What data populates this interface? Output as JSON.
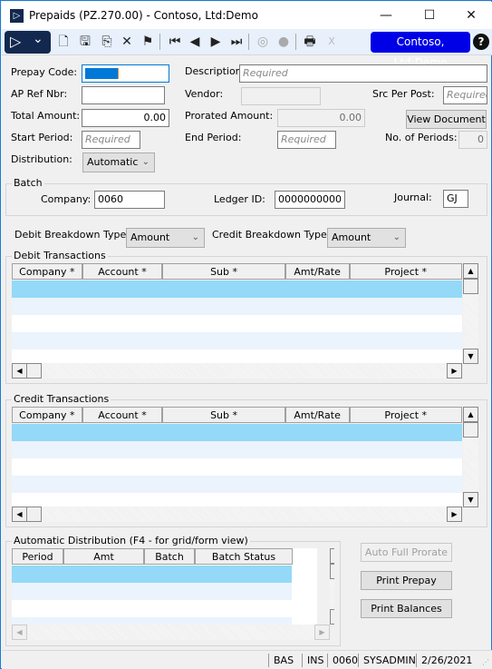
{
  "window": {
    "title": "Prepaids (PZ.270.00) - Contoso, Ltd:Demo",
    "minimize": "—",
    "maximize": "☐",
    "close": "✕"
  },
  "toolbar": {
    "main_menu_icon": "▷",
    "main_menu_chevron": "⌄",
    "icons": {
      "new": "🗋",
      "save": "🖫",
      "finish": "⎘",
      "delete": "✕",
      "cancel": "⚑",
      "first": "⏮",
      "prev": "◀",
      "next": "▶",
      "last": "⏭",
      "attach": "◎",
      "notes": "●",
      "print": "🖶",
      "excel": "X"
    },
    "company_badge": "Contoso, Ltd:Demo",
    "help": "?"
  },
  "form": {
    "prepay_code_label": "Prepay Code:",
    "prepay_code_value": "",
    "description_label": "Description:",
    "description_placeholder": "Required",
    "ap_ref_nbr_label": "AP Ref Nbr:",
    "ap_ref_nbr_value": "",
    "vendor_label": "Vendor:",
    "vendor_value": "",
    "src_per_post_label": "Src Per Post:",
    "src_per_post_placeholder": "Required",
    "total_amount_label": "Total Amount:",
    "total_amount_value": "0.00",
    "prorated_amount_label": "Prorated Amount:",
    "prorated_amount_value": "0.00",
    "view_document_button": "View Document",
    "start_period_label": "Start Period:",
    "start_period_placeholder": "Required",
    "end_period_label": "End Period:",
    "end_period_placeholder": "Required",
    "no_of_periods_label": "No. of Periods:",
    "no_of_periods_value": "0",
    "distribution_label": "Distribution:",
    "distribution_value": "Automatic"
  },
  "batch": {
    "title": "Batch",
    "company_label": "Company:",
    "company_value": "0060",
    "ledger_id_label": "Ledger ID:",
    "ledger_id_value": "0000000000",
    "journal_label": "Journal:",
    "journal_value": "GJ"
  },
  "breakdown": {
    "debit_label": "Debit Breakdown Type:",
    "debit_value": "Amount",
    "credit_label": "Credit Breakdown Type:",
    "credit_value": "Amount"
  },
  "debit_transactions": {
    "title": "Debit Transactions",
    "columns": [
      "Company *",
      "Account *",
      "Sub *",
      "Amt/Rate",
      "Project *"
    ]
  },
  "credit_transactions": {
    "title": "Credit Transactions",
    "columns": [
      "Company *",
      "Account *",
      "Sub *",
      "Amt/Rate",
      "Project *"
    ]
  },
  "auto_distribution": {
    "title": "Automatic Distribution (F4 - for grid/form view)",
    "columns": [
      "Period",
      "Amt",
      "Batch",
      "Batch Status"
    ]
  },
  "buttons": {
    "auto_full_prorate": "Auto Full Prorate",
    "print_prepay": "Print Prepay",
    "print_balances": "Print Balances"
  },
  "scroll": {
    "up": "▲",
    "down": "▼",
    "left": "◀",
    "right": "▶"
  },
  "status": {
    "mode": "BAS",
    "insert": "INS",
    "company": "0060",
    "user": "SYSADMIN",
    "date": "2/26/2021"
  },
  "colors": {
    "accent": "#0078d7",
    "company_badge": "#0000e6",
    "menu_dark": "#13284e",
    "selected_row": "#94d9f7",
    "alt_row": "#ebf3fd"
  }
}
